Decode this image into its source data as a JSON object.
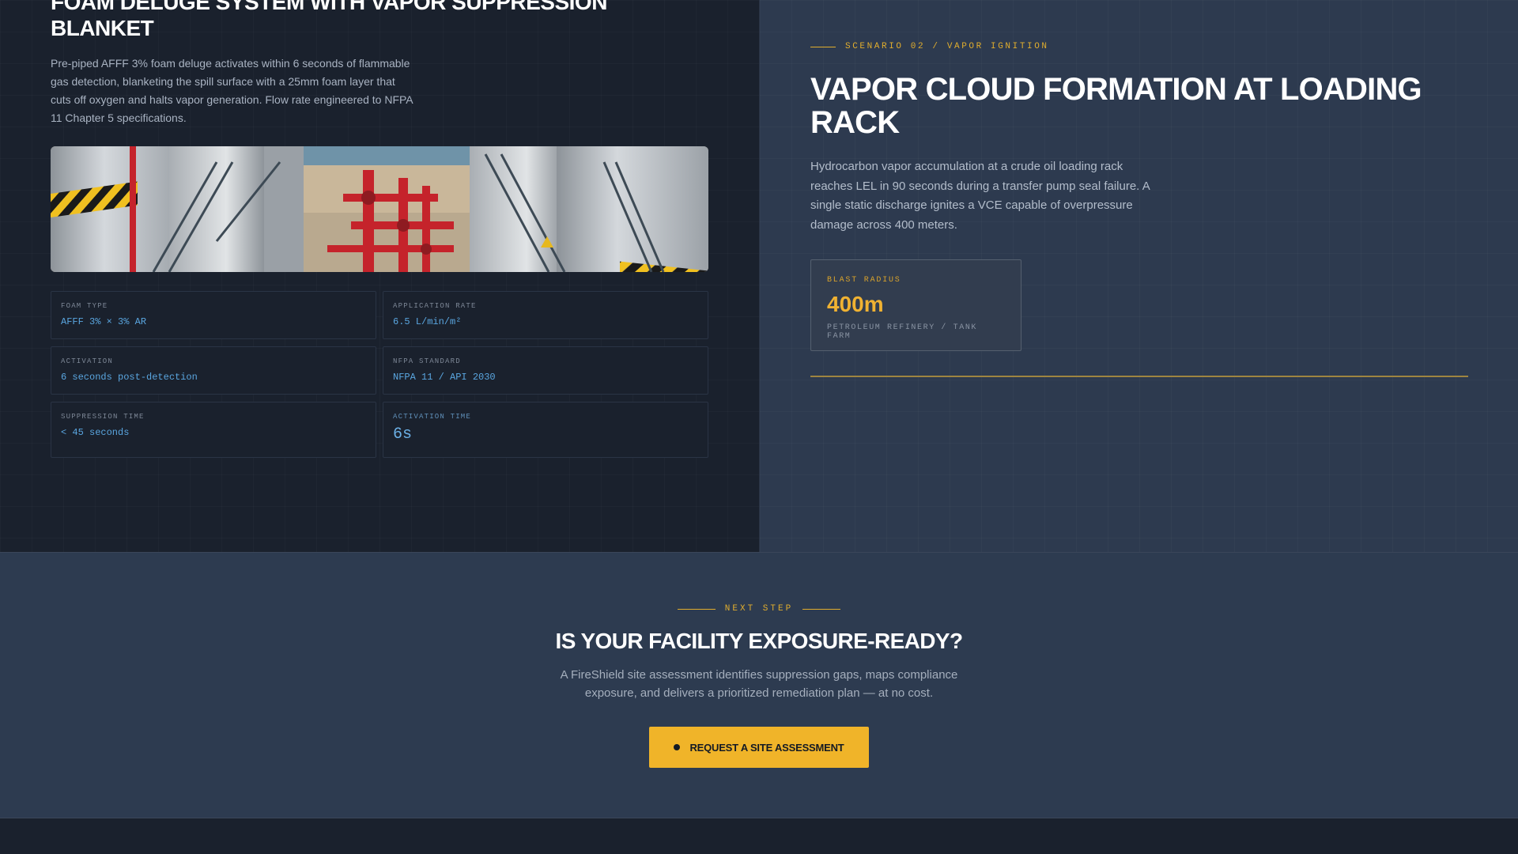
{
  "left": {
    "title": "FOAM DELUGE SYSTEM WITH VAPOR SUPPRESSION BLANKET",
    "description": "Pre-piped AFFF 3% foam deluge activates within 6 seconds of flammable gas detection, blanketing the spill surface with a 25mm foam layer that cuts off oxygen and halts vapor generation. Flow rate engineered to NFPA 11 Chapter 5 specifications.",
    "specs": [
      {
        "label": "FOAM TYPE",
        "value": "AFFF 3% × 3% AR"
      },
      {
        "label": "APPLICATION RATE",
        "value": "6.5 L/min/m²"
      },
      {
        "label": "ACTIVATION",
        "value": "6 seconds post-detection"
      },
      {
        "label": "NFPA STANDARD",
        "value": "NFPA 11 / API 2030"
      },
      {
        "label": "SUPPRESSION TIME",
        "value": "< 45 seconds"
      },
      {
        "label": "ACTIVATION TIME",
        "value": "6s"
      }
    ]
  },
  "right": {
    "eyebrow": "SCENARIO 02 / VAPOR IGNITION",
    "title": "VAPOR CLOUD FORMATION AT LOADING RACK",
    "description": "Hydrocarbon vapor accumulation at a crude oil loading rack reaches LEL in 90 seconds during a transfer pump seal failure. A single static discharge ignites a VCE capable of overpressure damage across 400 meters.",
    "stat": {
      "label": "BLAST RADIUS",
      "value": "400m",
      "sub": "PETROLEUM REFINERY / TANK FARM"
    }
  },
  "cta": {
    "eyebrow": "NEXT STEP",
    "title": "IS YOUR FACILITY EXPOSURE-READY?",
    "description": "A FireShield site assessment identifies suppression gaps, maps compliance exposure, and delivers a prioritized remediation plan — at no cost.",
    "button_label": "REQUEST A SITE ASSESSMENT"
  },
  "colors": {
    "accent": "#f0b429",
    "link": "#5aa6e0",
    "dark": "#1a212d",
    "slate": "#2d3b50"
  }
}
